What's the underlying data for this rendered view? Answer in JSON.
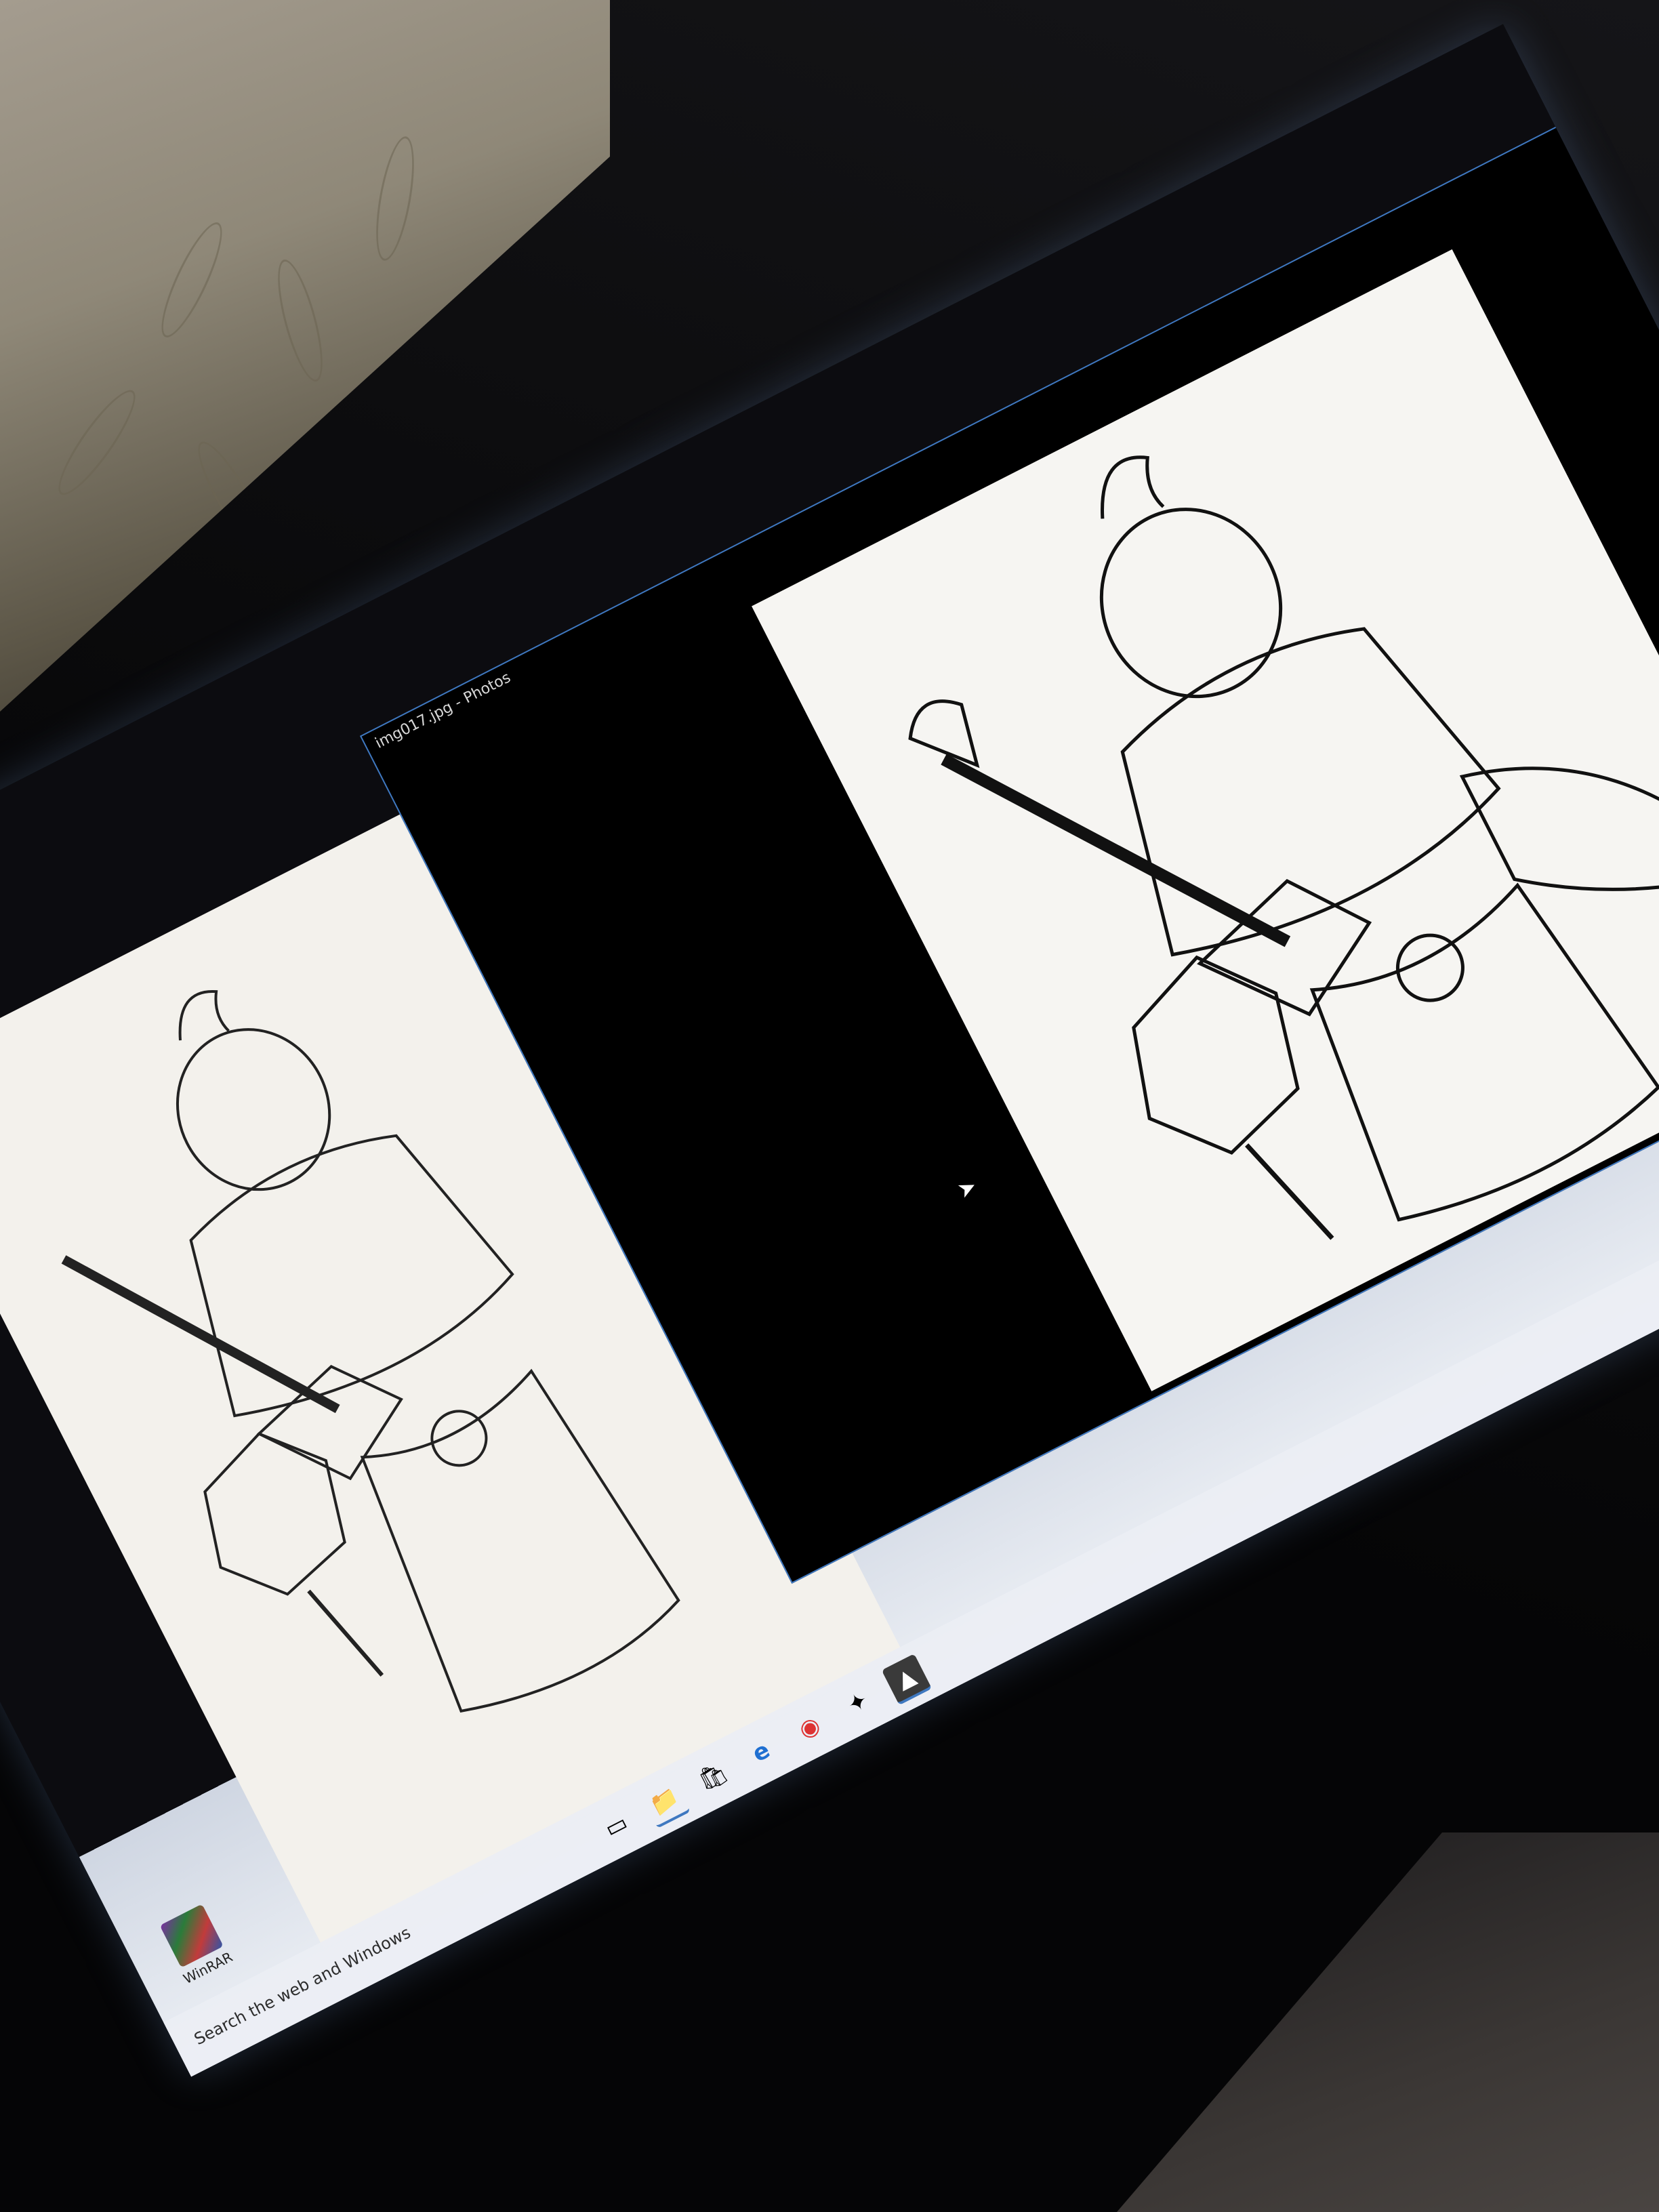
{
  "window": {
    "title": "img017.jpg - Photos"
  },
  "taskbar": {
    "search_placeholder": "Search the web and Windows",
    "icons": [
      {
        "name": "task-view-icon",
        "glyph": "▭"
      },
      {
        "name": "file-explorer-icon",
        "glyph": "📁"
      },
      {
        "name": "store-icon",
        "glyph": "🛍"
      },
      {
        "name": "edge-icon",
        "glyph": "e"
      },
      {
        "name": "chrome-icon",
        "glyph": "◉"
      },
      {
        "name": "app-icon",
        "glyph": "✦"
      },
      {
        "name": "photos-icon",
        "glyph": "▲"
      }
    ]
  },
  "desktop_icon": {
    "label": "WinRAR"
  },
  "colors": {
    "window_border": "#3f78c0",
    "paper": "#f3f1ec",
    "screen_bg": "#000000"
  }
}
